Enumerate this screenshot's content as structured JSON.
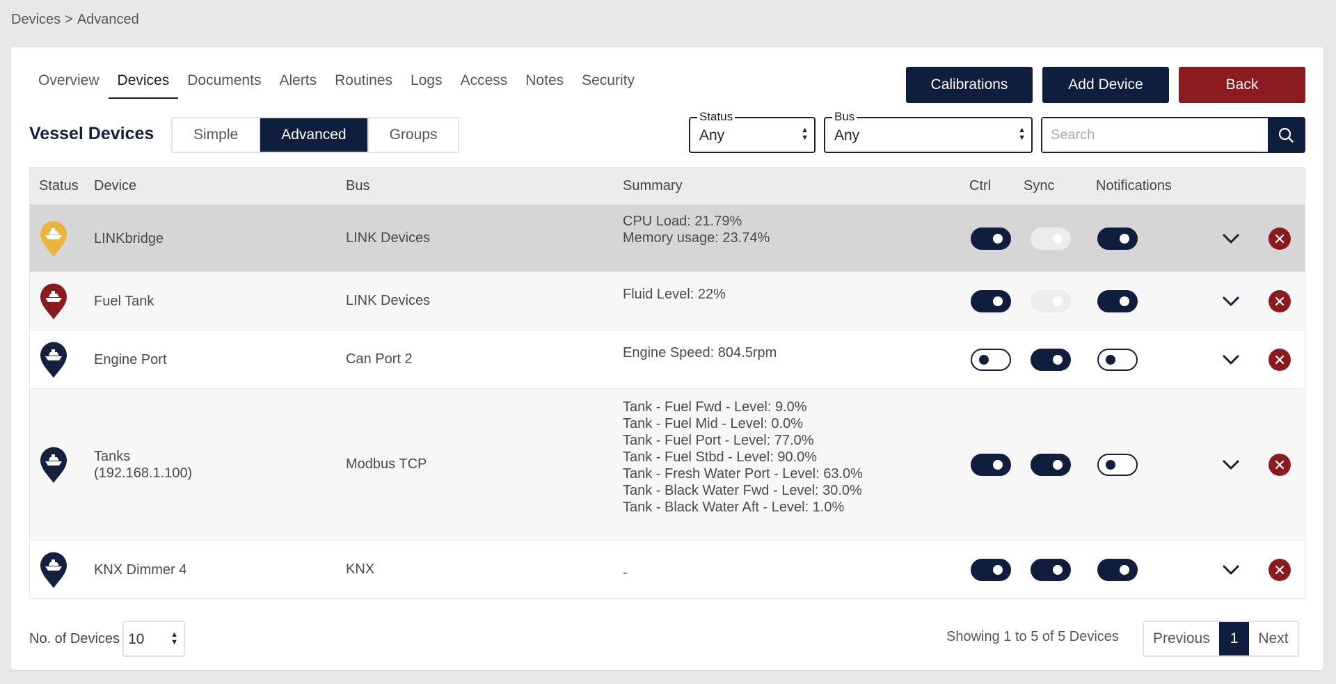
{
  "breadcrumb": {
    "root": "Devices",
    "separator": ">",
    "current": "Advanced"
  },
  "tabs": [
    "Overview",
    "Devices",
    "Documents",
    "Alerts",
    "Routines",
    "Logs",
    "Access",
    "Notes",
    "Security"
  ],
  "active_tab": "Devices",
  "actions": {
    "calibrations": "Calibrations",
    "add_device": "Add Device",
    "back": "Back"
  },
  "section_title": "Vessel Devices",
  "view_modes": [
    "Simple",
    "Advanced",
    "Groups"
  ],
  "active_view": "Advanced",
  "filters": {
    "status": {
      "label": "Status",
      "value": "Any"
    },
    "bus": {
      "label": "Bus",
      "value": "Any"
    },
    "search_placeholder": "Search"
  },
  "table": {
    "headers": {
      "status": "Status",
      "device": "Device",
      "bus": "Bus",
      "summary": "Summary",
      "ctrl": "Ctrl",
      "sync": "Sync",
      "notifications": "Notifications"
    },
    "rows": [
      {
        "status_color": "#e8b63c",
        "device": "LINKbridge",
        "bus": "LINK Devices",
        "summary": "CPU Load: 21.79%\nMemory usage: 23.74%",
        "ctrl": "on",
        "sync": "disabled",
        "notifications": "on"
      },
      {
        "status_color": "#8b1a1f",
        "device": "Fuel Tank",
        "bus": "LINK Devices",
        "summary": "Fluid Level: 22%",
        "ctrl": "on",
        "sync": "disabled",
        "notifications": "on"
      },
      {
        "status_color": "#13213f",
        "device": "Engine Port",
        "bus": "Can Port 2",
        "summary": "Engine Speed: 804.5rpm",
        "ctrl": "off",
        "sync": "on",
        "notifications": "off"
      },
      {
        "status_color": "#13213f",
        "device": "Tanks\n(192.168.1.100)",
        "bus": "Modbus TCP",
        "summary": "Tank - Fuel Fwd - Level: 9.0%\nTank - Fuel Mid - Level: 0.0%\nTank - Fuel Port - Level: 77.0%\nTank - Fuel Stbd - Level: 90.0%\nTank - Fresh Water Port - Level: 63.0%\nTank - Black Water Fwd - Level: 30.0%\nTank - Black Water Aft - Level: 1.0%",
        "ctrl": "on",
        "sync": "on",
        "notifications": "off"
      },
      {
        "status_color": "#13213f",
        "device": "KNX Dimmer 4",
        "bus": "KNX",
        "summary": "-",
        "ctrl": "on",
        "sync": "on",
        "notifications": "on"
      }
    ]
  },
  "footer": {
    "per_page_label": "No. of Devices",
    "per_page_value": "10",
    "showing": "Showing 1 to 5 of 5 Devices",
    "previous": "Previous",
    "page": "1",
    "next": "Next"
  }
}
